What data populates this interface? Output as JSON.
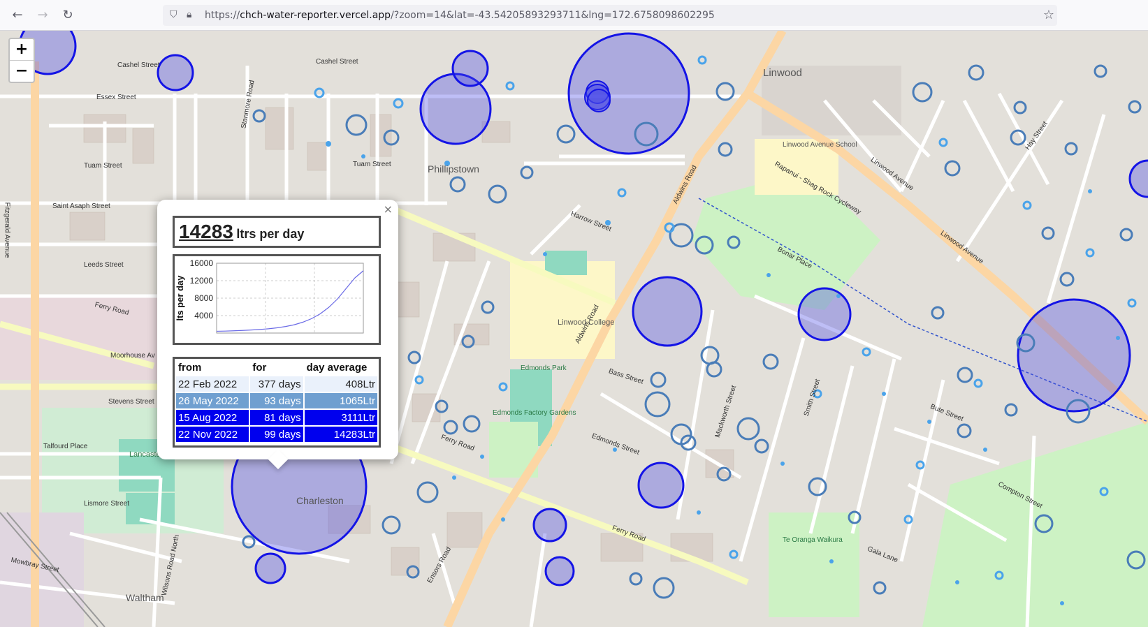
{
  "browser": {
    "back_icon": "back-arrow-icon",
    "forward_icon": "forward-arrow-icon",
    "reload_icon": "reload-icon",
    "url_prefix": "https://",
    "url_host": "chch-water-reporter.vercel.app",
    "url_path": "/?zoom=14&lat=-43.54205893293711&lng=172.6758098602295",
    "bookmark_icon": "star-icon"
  },
  "map": {
    "zoom_in": "+",
    "zoom_out": "−",
    "labels": {
      "linwood": "Linwood",
      "phillipstown": "Phillipstown",
      "charleston": "Charleston",
      "waltham": "Waltham",
      "linwood_college": "Linwood College",
      "linwood_avenue_school": "Linwood Avenue School",
      "edmonds_park": "Edmonds Park",
      "edmonds_factory_gardens": "Edmonds Factory Gardens",
      "lancaster_park": "Lancaster Park",
      "te_oranga_waikura": "Te Oranga Waikura",
      "cashel_street": "Cashel Street",
      "tuam_street": "Tuam Street",
      "saint_asaph_street": "Saint Asaph Street",
      "ferry_road": "Ferry Road",
      "moorhouse_avenue": "Moorhouse Av",
      "aldwins_road": "Aldwins Road",
      "linwood_avenue": "Linwood Avenue",
      "harrow_street": "Harrow Street",
      "fitzgerald_avenue": "Fitzgerald Avenue",
      "stanmore_road": "Stanmore Road",
      "ensors_road": "Ensors Road",
      "smith_street": "Smith Street",
      "stevens_street": "Stevens Street",
      "leeds_street": "Leeds Street",
      "essex_street": "Essex Street",
      "edmonds_street": "Edmonds Street",
      "bass_street": "Bass Street",
      "wilsons_road_north": "Wilsons Road North",
      "lismore_street": "Lismore Street",
      "mowbray_street": "Mowbray Street",
      "talfourd_place": "Talfourd Place",
      "bonar_place": "Bonar Place",
      "rapanui_cycleway": "Rapanui - Shag Rock Cycleway",
      "gala_lane": "Gala Lane",
      "compton_street": "Compton Street",
      "bute_street": "Bute Street",
      "mackworth_street": "Mackworth Street",
      "hay_street": "Hay Street"
    }
  },
  "popup": {
    "close_label": "×",
    "value": "14283",
    "unit_label": "ltrs per day",
    "table_headers": [
      "from",
      "for",
      "day average"
    ],
    "rows": [
      {
        "from": "22 Feb 2022",
        "for": "377 days",
        "avg": "408Ltr",
        "bg": "#eaf1fb",
        "fg": "#222222"
      },
      {
        "from": "26 May 2022",
        "for": "93 days",
        "avg": "1065Ltr",
        "bg": "#6f9fd0",
        "fg": "#ffffff"
      },
      {
        "from": "15 Aug 2022",
        "for": "81 days",
        "avg": "3111Ltr",
        "bg": "#0000ee",
        "fg": "#ffffff"
      },
      {
        "from": "22 Nov 2022",
        "for": "99 days",
        "avg": "14283Ltr",
        "bg": "#0000ee",
        "fg": "#ffffff"
      }
    ]
  },
  "chart_data": {
    "type": "line",
    "ylabel": "lts per day",
    "xlabel": "",
    "ylim": [
      0,
      16000
    ],
    "yticks": [
      4000,
      8000,
      12000,
      16000
    ],
    "grid": true,
    "series": [
      {
        "values": [
          408,
          450,
          520,
          600,
          700,
          820,
          980,
          1200,
          1500,
          1900,
          2500,
          3300,
          4400,
          5900,
          7800,
          10200,
          12600,
          14283
        ]
      }
    ]
  }
}
